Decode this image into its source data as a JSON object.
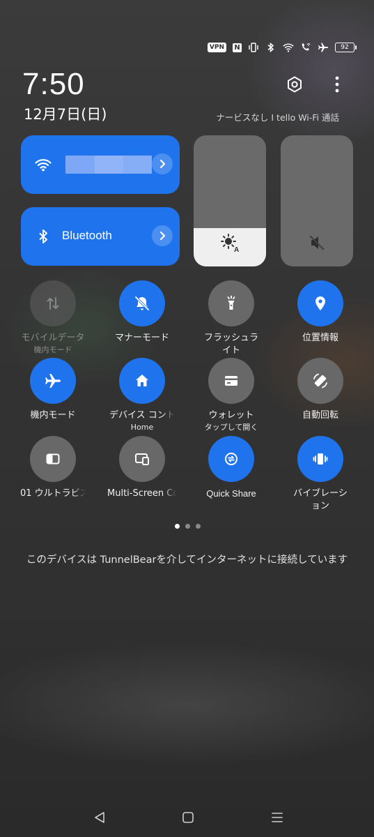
{
  "status_bar": {
    "vpn_badge": "VPN",
    "nfc_badge": "N",
    "battery_level": "92",
    "icons": [
      "vibrate-icon",
      "bluetooth-icon",
      "wifi-icon",
      "wifi-calling-icon",
      "airplane-icon",
      "battery-icon"
    ]
  },
  "header": {
    "time": "7:50",
    "date": "12月7日(日)",
    "carrier_text": "ナービスなし I tello Wi-Fi 通話",
    "icons": [
      "settings-icon",
      "more-vert-icon"
    ]
  },
  "big_tiles": {
    "wifi": {
      "label": "",
      "icon": "wifi-icon",
      "state": "on"
    },
    "bluetooth": {
      "label": "Bluetooth",
      "icon": "bluetooth-icon",
      "state": "on"
    }
  },
  "sliders": {
    "brightness": {
      "level": 0.29,
      "icon": "brightness-auto-icon"
    },
    "volume": {
      "level": 0.0,
      "icon": "volume-mute-icon"
    }
  },
  "toggles": [
    {
      "id": "mobile-data",
      "label": "モバイルデータ",
      "sub": "機内モード",
      "state": "disabled",
      "icon": "data-arrows-icon"
    },
    {
      "id": "silent-mode",
      "label": "マナーモード",
      "sub": "",
      "state": "on",
      "icon": "bell-off-icon"
    },
    {
      "id": "flashlight",
      "label": "フラッシュラ",
      "sub": "イト",
      "state": "off",
      "icon": "flashlight-icon"
    },
    {
      "id": "location",
      "label": "位置情報",
      "sub": "",
      "state": "on",
      "icon": "location-pin-icon"
    },
    {
      "id": "airplane-mode",
      "label": "機内モード",
      "sub": "",
      "state": "on",
      "icon": "airplane-icon"
    },
    {
      "id": "device-control",
      "label": "デバイス コント",
      "sub": "Home",
      "state": "on",
      "icon": "home-icon"
    },
    {
      "id": "wallet",
      "label": "ウォレット",
      "sub": "タップして開く",
      "state": "off",
      "icon": "wallet-card-icon"
    },
    {
      "id": "auto-rotate",
      "label": "自動回転",
      "sub": "",
      "state": "off",
      "icon": "auto-rotate-icon"
    },
    {
      "id": "ultra-battery",
      "label": "01 ウルトラビズ",
      "sub": "",
      "state": "off",
      "icon": "ultra-battery-icon"
    },
    {
      "id": "multi-screen",
      "label": "Multi-Screen Co",
      "sub": "",
      "state": "off",
      "icon": "multi-screen-icon"
    },
    {
      "id": "quick-share",
      "label": "Quick Share",
      "sub": "",
      "state": "on",
      "icon": "quick-share-icon"
    },
    {
      "id": "vibration",
      "label": "バイブレーシ",
      "sub": "ョン",
      "state": "on",
      "icon": "vibration-icon"
    }
  ],
  "pager": {
    "pages": 3,
    "current": 1
  },
  "vpn_message": "このデバイスは TunnelBearを介してインターネットに接続しています",
  "nav_bar": {
    "icons": [
      "back-icon",
      "home-icon",
      "recents-icon"
    ]
  }
}
